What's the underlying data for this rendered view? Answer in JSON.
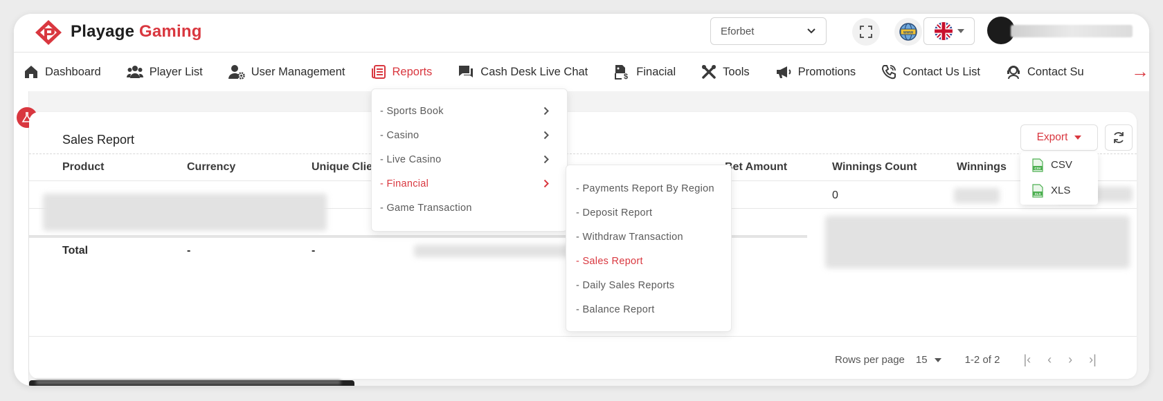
{
  "brand": {
    "part1": "Playage",
    "part2": "Gaming"
  },
  "header": {
    "operator_select": "Eforbet"
  },
  "nav": [
    {
      "label": "Dashboard",
      "icon": "home-icon"
    },
    {
      "label": "Player List",
      "icon": "users-icon"
    },
    {
      "label": "User Management",
      "icon": "user-gear-icon"
    },
    {
      "label": "Reports",
      "icon": "report-icon",
      "active": true
    },
    {
      "label": "Cash Desk Live Chat",
      "icon": "chat-icon"
    },
    {
      "label": "Finacial",
      "icon": "money-file-icon"
    },
    {
      "label": "Tools",
      "icon": "tools-icon"
    },
    {
      "label": "Promotions",
      "icon": "megaphone-icon"
    },
    {
      "label": "Contact Us List",
      "icon": "phone-icon"
    },
    {
      "label": "Contact Su",
      "icon": "support-icon"
    }
  ],
  "reports_menu": [
    {
      "label": "- Sports Book",
      "has_sub": true
    },
    {
      "label": "- Casino",
      "has_sub": true
    },
    {
      "label": "- Live Casino",
      "has_sub": true
    },
    {
      "label": "- Financial",
      "has_sub": true,
      "active": true
    },
    {
      "label": "- Game Transaction",
      "has_sub": false
    }
  ],
  "financial_menu": [
    {
      "label": "- Payments Report By Region"
    },
    {
      "label": "- Deposit Report"
    },
    {
      "label": "- Withdraw Transaction"
    },
    {
      "label": "- Sales Report",
      "active": true
    },
    {
      "label": "- Daily Sales Reports"
    },
    {
      "label": "- Balance Report"
    }
  ],
  "card": {
    "title": "Sales Report",
    "export_label": "Export",
    "export_options": [
      "CSV",
      "XLS"
    ]
  },
  "table": {
    "columns": [
      "Product",
      "Currency",
      "Unique Clients",
      "Bet Amount",
      "Winnings Count",
      "Winnings"
    ],
    "row1": {
      "winnings_count": "0"
    },
    "total": {
      "product": "Total",
      "currency": "-",
      "unique_clients": "-"
    }
  },
  "pagination": {
    "rows_per_page_label": "Rows per page",
    "rows_per_page_value": "15",
    "range": "1-2 of 2"
  },
  "colors": {
    "accent": "#d9373f"
  }
}
